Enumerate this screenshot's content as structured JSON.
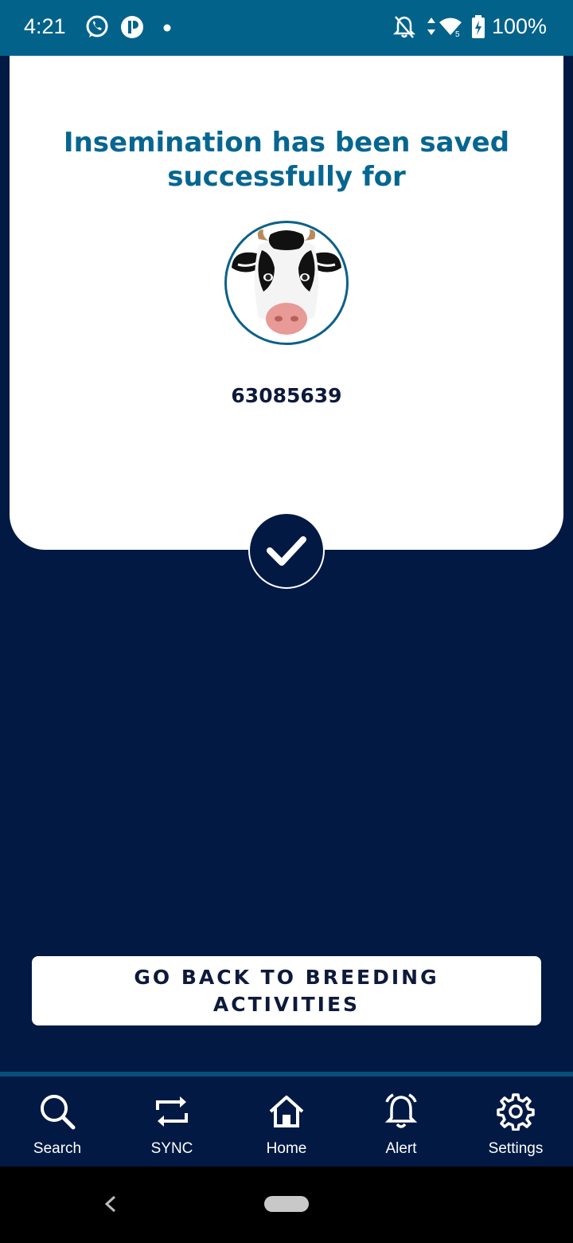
{
  "status_bar": {
    "time": "4:21",
    "battery": "100%",
    "icons": [
      "whatsapp-icon",
      "app-notification-icon",
      "dot-icon",
      "bell-off-icon",
      "data-arrows-icon",
      "wifi-icon",
      "battery-charging-icon"
    ]
  },
  "card": {
    "title": "Insemination has been saved successfully for",
    "animal_id": "63085639",
    "avatar_icon": "cow-face-icon",
    "status_icon": "checkmark-icon"
  },
  "actions": {
    "back_button": "GO BACK TO BREEDING ACTIVITIES"
  },
  "nav": {
    "items": [
      {
        "label": "Search",
        "icon": "search-icon"
      },
      {
        "label": "SYNC",
        "icon": "sync-icon"
      },
      {
        "label": "Home",
        "icon": "home-icon"
      },
      {
        "label": "Alert",
        "icon": "alert-bell-icon"
      },
      {
        "label": "Settings",
        "icon": "gear-icon"
      }
    ]
  },
  "colors": {
    "status_bar": "#03628a",
    "background": "#021944",
    "accent": "#066691",
    "card": "#ffffff"
  }
}
